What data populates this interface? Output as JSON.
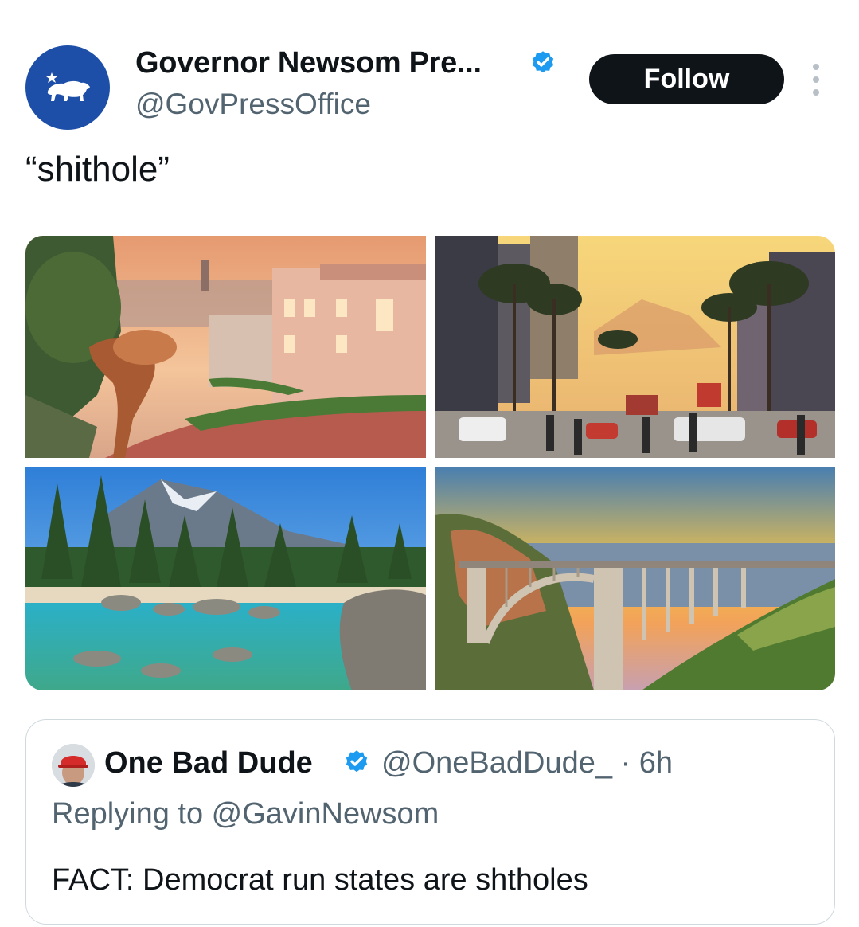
{
  "post": {
    "display_name": "Governor Newsom Pre...",
    "handle": "@GovPressOffice",
    "follow_label": "Follow",
    "text": "“shithole”",
    "avatar_icon": "california-bear-flag-icon",
    "verified_icon": "verified-badge-icon",
    "more_icon": "more-vertical-icon",
    "images": [
      {
        "subject": "san-francisco-lombard-street"
      },
      {
        "subject": "hollywood-boulevard"
      },
      {
        "subject": "lake-tahoe-shoreline"
      },
      {
        "subject": "bixby-creek-bridge"
      }
    ]
  },
  "quote": {
    "display_name": "One Bad Dude",
    "handle_time": "@OneBadDude_ · 6h",
    "reply_context": "Replying to @GavinNewsom",
    "text": "FACT: Democrat run states are shtholes"
  },
  "colors": {
    "text_primary": "#0f1419",
    "text_secondary": "#536471",
    "verified_blue": "#1d9bf0",
    "avatar_blue": "#1d4fa8",
    "button_dark": "#0f1419",
    "border": "#cfd9de"
  }
}
